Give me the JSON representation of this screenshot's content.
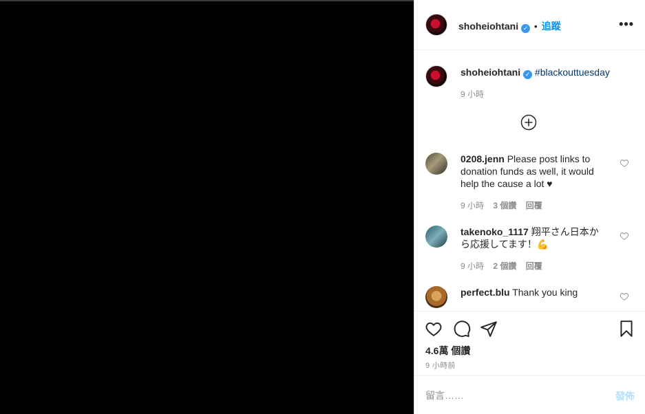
{
  "post": {
    "username": "shoheiohtani",
    "follow_label": "追蹤",
    "separator": "•",
    "more_icon": "more-horizontal-icon"
  },
  "caption": {
    "username": "shoheiohtani",
    "text": "#blackouttuesday",
    "time": "9 小時"
  },
  "comments": [
    {
      "username": "0208.jenn",
      "text": "Please post links to donation funds as well, it would help the cause a lot ♥",
      "time": "9 小時",
      "likes": "3 個讚",
      "reply": "回覆"
    },
    {
      "username": "takenoko_1117",
      "text": "翔平さん日本から応援してます！💪",
      "time": "9 小時",
      "likes": "2 個讚",
      "reply": "回覆"
    },
    {
      "username": "perfect.blu",
      "text": "Thank you king"
    }
  ],
  "footer": {
    "likes": "4.6萬 個讚",
    "posted_ago": "9 小時前"
  },
  "composer": {
    "placeholder": "留言……",
    "post_label": "發佈"
  },
  "colors": {
    "accent": "#0095f6",
    "verified": "#3897f0",
    "muted": "#8e8e8e",
    "post_disabled": "#b2dffc"
  }
}
